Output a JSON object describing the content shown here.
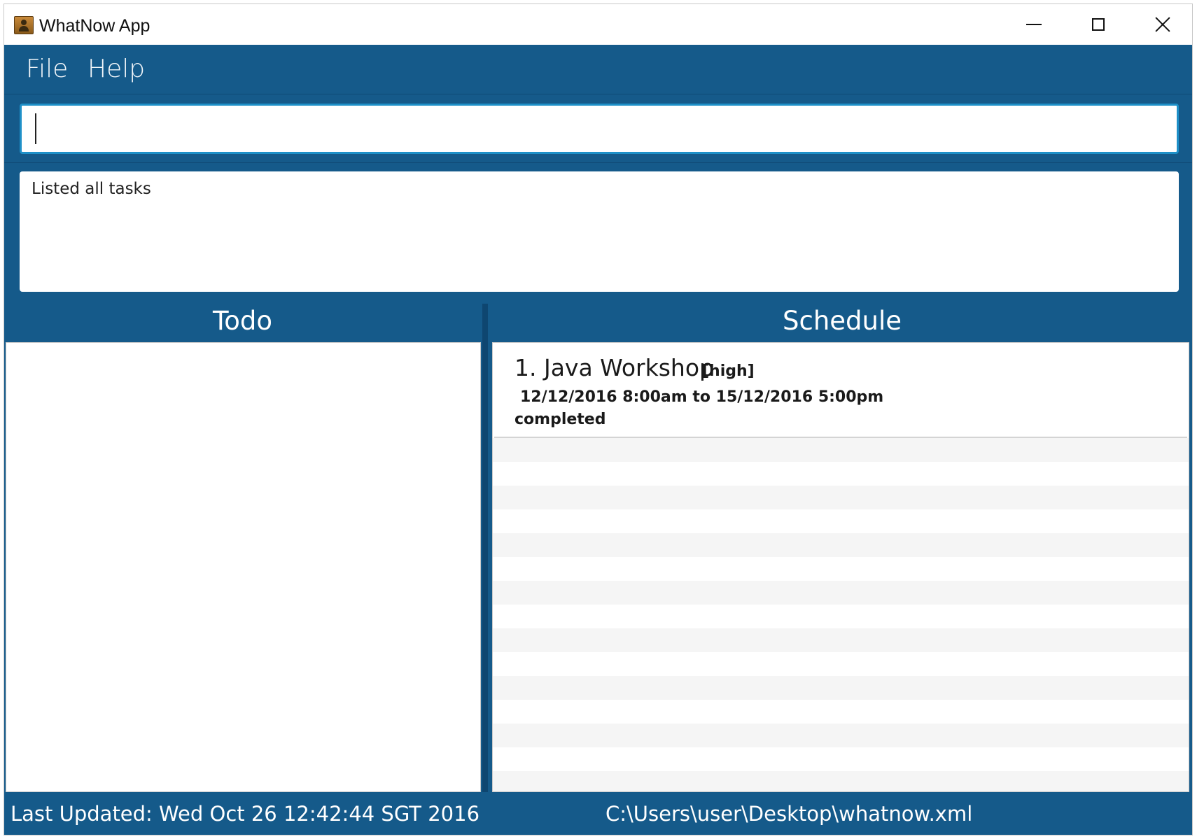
{
  "window": {
    "title": "WhatNow App"
  },
  "menu": {
    "items": [
      {
        "label": "File"
      },
      {
        "label": "Help"
      }
    ]
  },
  "command": {
    "value": ""
  },
  "result": {
    "message": "Listed all tasks"
  },
  "todo": {
    "header": "Todo",
    "items": []
  },
  "schedule": {
    "header": "Schedule",
    "items": [
      {
        "title": "1. Java Workshop",
        "priority": "[high]",
        "time": "12/12/2016 8:00am to 15/12/2016 5:00pm",
        "status": "completed"
      }
    ]
  },
  "statusbar": {
    "last_updated": "Last Updated: Wed Oct 26 12:42:44 SGT 2016",
    "path": "C:\\Users\\user\\Desktop\\whatnow.xml"
  },
  "colors": {
    "app_background": "#155a8a",
    "input_focus_border": "#1e90c8"
  }
}
